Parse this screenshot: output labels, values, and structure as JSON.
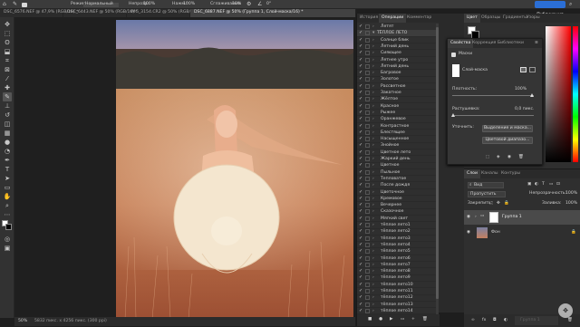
{
  "option_bar": {
    "mode_label": "Режим:",
    "mode_value": "Нормальный",
    "opacity_label": "Непрозр.:",
    "opacity_value": "100%",
    "flow_label": "Нажм.:",
    "flow_value": "100%",
    "smoothing_label": "Сглаживание:",
    "smoothing_value": "10%",
    "angle_value": "0°",
    "publish_label": "Публикация"
  },
  "doc_tabs": [
    "DSC_6576.NEF @ 47,9% (RGB/16) *",
    "DSC_6443.NEF @ 50% (RGB/16) *",
    "IMG_3154.CR2 @ 50% (RGB/16) *",
    "DSC_6887.NEF @ 50% (Группа 1, Слой-маска/16) *"
  ],
  "status_bar": {
    "zoom": "50%",
    "doc_info": "5832 пикс. x 4256 пикс. (300 ppi)"
  },
  "actions_panel": {
    "tabs": [
      "История",
      "Операции",
      "Комментар"
    ],
    "active_tab": "Операции",
    "items": [
      "Летят",
      "ТЁПЛОЕ ЛЕТО",
      "Солнце блик",
      "Летний день",
      "Сияющее",
      "Летнее утро",
      "Летний день",
      "Багровое",
      "Золотое",
      "Рассветное",
      "Закатное",
      "Жёлтое",
      "Красное",
      "Рыжее",
      "Оранжевое",
      "Контрастное",
      "Блестящее",
      "Насыщенное",
      "Знойное",
      "Цветное лето",
      "Жаркий день",
      "Цветное",
      "Пыльное",
      "Тепловатое",
      "После дождя",
      "Цветочное",
      "Кремовое",
      "Вечернее",
      "Сказочное",
      "Мягкий свет",
      "тёплое лето1",
      "тёплое лето2",
      "тёплое лето3",
      "тёплое лето4",
      "тёплое лето5",
      "тёплое лето6",
      "тёплое лето7",
      "тёплое лето8",
      "тёплое лето9",
      "тёплое лето10",
      "тёплое лето11",
      "тёплое лето12",
      "тёплое лето13",
      "тёплое лето14"
    ]
  },
  "properties_panel": {
    "tabs": [
      "Свойства",
      "Коррекция",
      "Библиотеки"
    ],
    "active_tab": "Свойства",
    "section_masks": "Маски",
    "layer_mask_label": "Слой-маска",
    "density_label": "Плотность:",
    "density_value": "100%",
    "feather_label": "Растушевка:",
    "feather_value": "0,0 пикс.",
    "refine_label": "Уточнить:",
    "select_mask_button": "Выделение и маска...",
    "color_range_button": "Цветовой диапазо..."
  },
  "color_panel": {
    "tabs": [
      "Цвет",
      "Образцы",
      "Градиенты",
      "Узоры"
    ],
    "active_tab": "Цвет",
    "hue_colors": [
      "#ff0000",
      "#ff00ff",
      "#0000ff",
      "#00ffff",
      "#00ff00",
      "#ffff00",
      "#ff0000"
    ]
  },
  "layers_panel": {
    "tabs": [
      "Слои",
      "Каналы",
      "Контуры"
    ],
    "active_tab": "Слои",
    "filter_label": "Вид",
    "blend_mode": "Пропустить",
    "opacity_label": "Непрозрачность:",
    "opacity_value": "100%",
    "lock_label": "Закрепить:",
    "fill_label": "Заливка:",
    "fill_value": "100%",
    "layers": [
      {
        "name": "Группа 1",
        "selected": true
      },
      {
        "name": "Фон",
        "selected": false
      }
    ],
    "extra_layer_label": "Группа 1"
  }
}
